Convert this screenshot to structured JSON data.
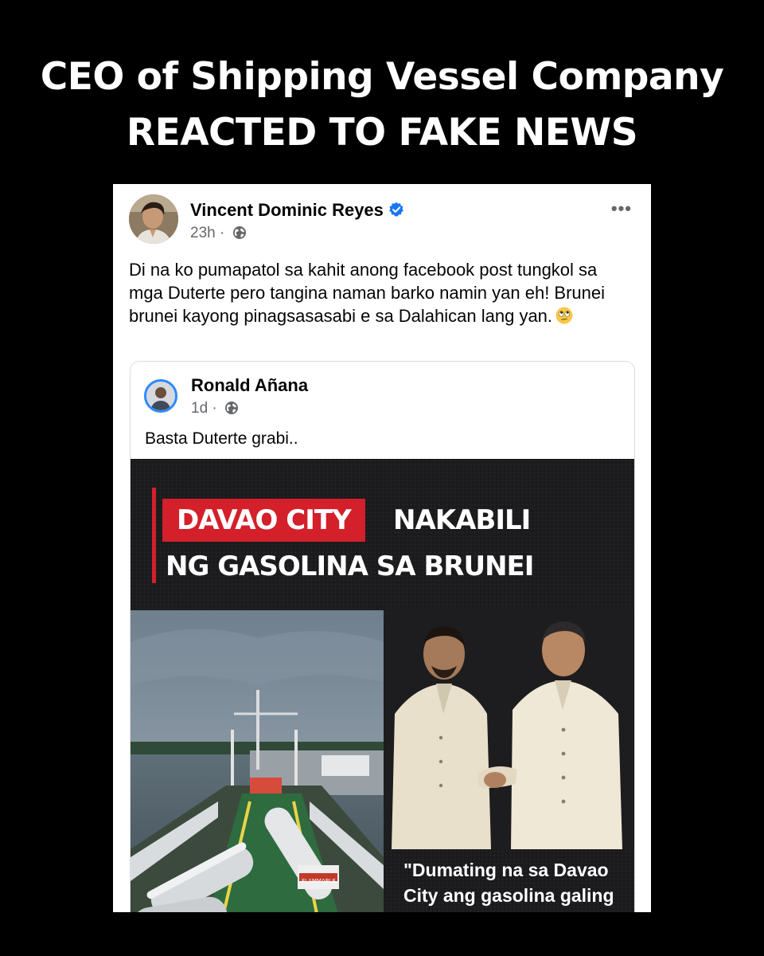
{
  "headline": {
    "line1": "CEO of Shipping Vessel Company",
    "line2": "REACTED TO FAKE NEWS"
  },
  "post": {
    "author": "Vincent Dominic Reyes",
    "time": "23h",
    "separator": "·",
    "more_label": "•••",
    "text": "Di na ko pumapatol sa kahit anong facebook post tungkol sa mga Duterte pero tangina naman barko namin yan eh! Brunei brunei kayong pinagsasasabi e sa Dalahican lang yan.",
    "emoji": "face-with-rolling-eyes",
    "icons": {
      "verified": "verified-badge-icon",
      "audience": "globe-icon"
    },
    "colors": {
      "verified": "#1877f2",
      "meta_text": "#65676b"
    }
  },
  "shared_post": {
    "author": "Ronald Añana",
    "time": "1d",
    "separator": "·",
    "text": "Basta Duterte grabi..",
    "image": {
      "tag": "DAVAO CITY",
      "line1_rest": "NAKABILI",
      "line2": "NG GASOLINA SA BRUNEI",
      "truck_label": "FLAMMABLE",
      "quote_line1": "\"Dumating na sa Davao",
      "quote_line2": "City ang gasolina galing",
      "colors": {
        "tag_bg": "#d3202a",
        "background": "#1b1b1d"
      }
    }
  }
}
